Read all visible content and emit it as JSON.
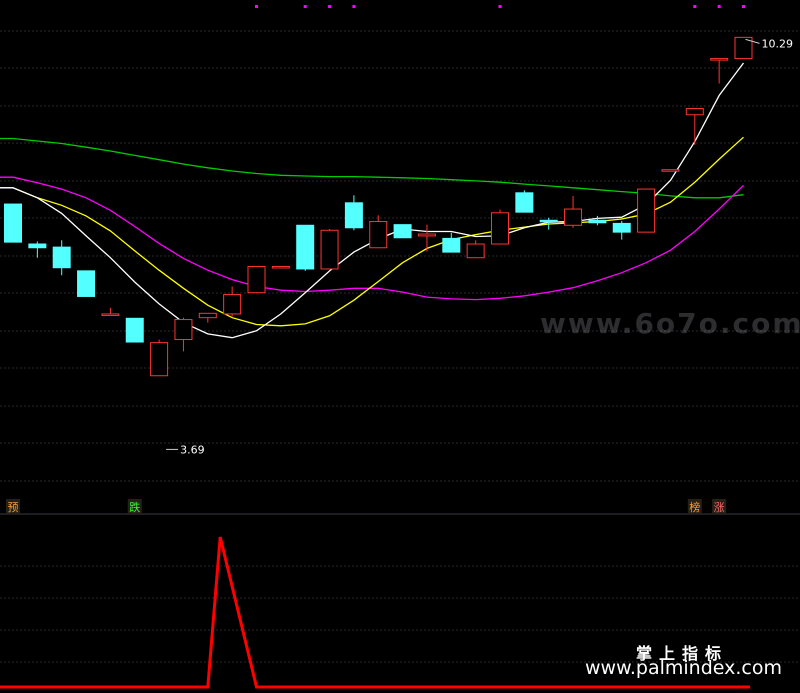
{
  "chart_data": {
    "type": "candlestick",
    "colors": {
      "up": "#ff3333",
      "down": "#54ffff",
      "ma_white": "#ffffff",
      "ma_yellow": "#ffff00",
      "ma_magenta": "#ff00ff",
      "ma_green": "#00cc00",
      "indicator": "#ff0000",
      "grid": "#2a2a30",
      "marker_dot": "#ff00ff"
    },
    "price_range": [
      3.2,
      10.6
    ],
    "candles": [
      {
        "o": 7.62,
        "c": 7.01,
        "h": 7.62,
        "l": 7.01
      },
      {
        "o": 6.98,
        "c": 6.92,
        "h": 7.02,
        "l": 6.76
      },
      {
        "o": 6.93,
        "c": 6.6,
        "h": 7.04,
        "l": 6.48
      },
      {
        "o": 6.55,
        "c": 6.14,
        "h": 6.55,
        "l": 6.14
      },
      {
        "o": 5.86,
        "c": 5.86,
        "h": 5.96,
        "l": 5.84
      },
      {
        "o": 5.79,
        "c": 5.41,
        "h": 5.79,
        "l": 5.41
      },
      {
        "o": 4.87,
        "c": 5.4,
        "h": 5.45,
        "l": 4.87
      },
      {
        "o": 5.45,
        "c": 5.77,
        "h": 5.8,
        "l": 5.26
      },
      {
        "o": 5.8,
        "c": 5.87,
        "h": 5.87,
        "l": 5.72
      },
      {
        "o": 5.86,
        "c": 6.17,
        "h": 6.3,
        "l": 5.82
      },
      {
        "o": 6.2,
        "c": 6.62,
        "h": 6.62,
        "l": 6.19
      },
      {
        "o": 6.62,
        "c": 6.62,
        "h": 6.62,
        "l": 6.6
      },
      {
        "o": 7.28,
        "c": 6.58,
        "h": 7.28,
        "l": 6.55
      },
      {
        "o": 6.58,
        "c": 7.2,
        "h": 7.22,
        "l": 6.57
      },
      {
        "o": 7.64,
        "c": 7.24,
        "h": 7.76,
        "l": 7.2
      },
      {
        "o": 6.92,
        "c": 7.34,
        "h": 7.44,
        "l": 6.92
      },
      {
        "o": 7.29,
        "c": 7.08,
        "h": 7.29,
        "l": 7.08
      },
      {
        "o": 7.11,
        "c": 7.14,
        "h": 7.29,
        "l": 6.86
      },
      {
        "o": 7.07,
        "c": 6.85,
        "h": 7.16,
        "l": 6.85
      },
      {
        "o": 6.76,
        "c": 6.98,
        "h": 7.04,
        "l": 6.76
      },
      {
        "o": 6.98,
        "c": 7.48,
        "h": 7.53,
        "l": 6.98
      },
      {
        "o": 7.8,
        "c": 7.49,
        "h": 7.84,
        "l": 7.49
      },
      {
        "o": 7.36,
        "c": 7.35,
        "h": 7.4,
        "l": 7.21
      },
      {
        "o": 7.28,
        "c": 7.54,
        "h": 7.75,
        "l": 7.24
      },
      {
        "o": 7.36,
        "c": 7.32,
        "h": 7.43,
        "l": 7.28
      },
      {
        "o": 7.31,
        "c": 7.17,
        "h": 7.35,
        "l": 7.05
      },
      {
        "o": 7.17,
        "c": 7.86,
        "h": 7.86,
        "l": 7.17
      },
      {
        "o": 8.17,
        "c": 8.17,
        "h": 8.17,
        "l": 8.17
      },
      {
        "o": 9.05,
        "c": 9.15,
        "h": 9.15,
        "l": 8.57
      },
      {
        "o": 9.95,
        "c": 9.95,
        "h": 9.95,
        "l": 9.55
      },
      {
        "o": 9.95,
        "c": 10.29,
        "h": 10.29,
        "l": 9.95
      }
    ],
    "moving_averages": {
      "white": [
        7.88,
        7.72,
        7.47,
        7.11,
        6.76,
        6.37,
        6.02,
        5.72,
        5.54,
        5.48,
        5.59,
        5.86,
        6.2,
        6.55,
        6.85,
        7.06,
        7.22,
        7.18,
        7.18,
        7.1,
        7.11,
        7.24,
        7.33,
        7.34,
        7.39,
        7.41,
        7.61,
        8.0,
        8.62,
        9.36,
        9.88
      ],
      "yellow": [
        7.88,
        7.72,
        7.6,
        7.43,
        7.19,
        6.87,
        6.56,
        6.27,
        6.0,
        5.8,
        5.69,
        5.67,
        5.7,
        5.83,
        6.08,
        6.38,
        6.68,
        6.91,
        7.05,
        7.13,
        7.2,
        7.25,
        7.3,
        7.32,
        7.34,
        7.38,
        7.46,
        7.65,
        7.97,
        8.34,
        8.69
      ],
      "magenta": [
        8.05,
        7.96,
        7.86,
        7.72,
        7.52,
        7.26,
        6.99,
        6.75,
        6.56,
        6.41,
        6.3,
        6.24,
        6.22,
        6.24,
        6.27,
        6.27,
        6.21,
        6.13,
        6.1,
        6.09,
        6.11,
        6.15,
        6.21,
        6.28,
        6.39,
        6.52,
        6.68,
        6.88,
        7.18,
        7.54,
        7.92
      ],
      "green": [
        8.67,
        8.63,
        8.59,
        8.53,
        8.47,
        8.4,
        8.33,
        8.26,
        8.2,
        8.15,
        8.11,
        8.08,
        8.07,
        8.06,
        8.06,
        8.05,
        8.04,
        8.03,
        8.01,
        7.99,
        7.97,
        7.94,
        7.91,
        7.88,
        7.85,
        7.82,
        7.79,
        7.75,
        7.72,
        7.72,
        7.77
      ]
    },
    "price_labels": {
      "high": {
        "text": "10.29",
        "index": 30,
        "value": 10.29
      },
      "low": {
        "text": "3.69",
        "index": 6,
        "value": 3.69
      }
    },
    "signal_tags": [
      {
        "text": "预",
        "index": 0,
        "color": "#ff9933"
      },
      {
        "text": "跌",
        "index": 5,
        "color": "#33ff33"
      },
      {
        "text": "榜",
        "index": 28,
        "color": "#ff9933"
      },
      {
        "text": "涨",
        "index": 29,
        "color": "#ff6666"
      }
    ],
    "top_markers": [
      10,
      12,
      13,
      14,
      20,
      28,
      29,
      30
    ],
    "indicator": {
      "values": [
        0,
        0,
        0,
        0,
        0,
        0,
        0,
        0,
        0,
        1,
        0,
        0,
        0,
        0,
        0,
        0,
        0,
        0,
        0,
        0,
        0,
        0,
        0,
        0,
        0,
        0,
        0,
        0,
        0,
        0,
        0
      ],
      "ylim": [
        0,
        1
      ]
    }
  },
  "watermarks": {
    "center": "www.6o7o.com",
    "title": "掌上指标",
    "url": "www.palmindex.com"
  }
}
